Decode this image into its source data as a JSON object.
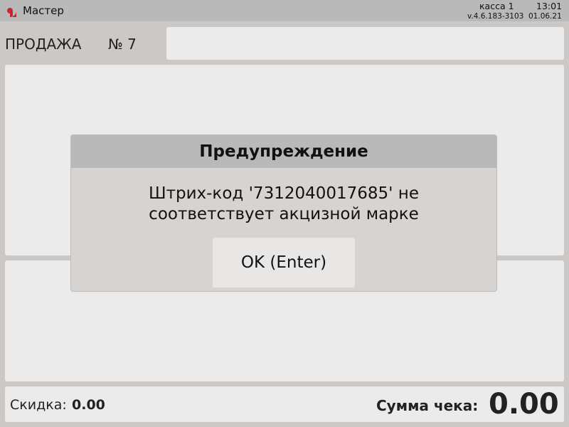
{
  "colors": {
    "background": "#cbc8c5",
    "topbar": "#b9b9b9",
    "panel": "#ebebeb",
    "dialog_body": "#d6d3d0",
    "dialog_header": "#b9b9b9",
    "logo_red": "#c8262f"
  },
  "header": {
    "logo_icon": "app-logo-icon",
    "app_title": "Мастер",
    "register": "касса 1",
    "time": "13:01",
    "version": "v.4.6.183-3103  01.06.21"
  },
  "sale": {
    "label": "ПРОДАЖА",
    "number": "№ 7"
  },
  "footer": {
    "discount_label": "Скидка:",
    "discount_value": "0.00",
    "total_label": "Сумма чека:",
    "total_value": "0.00"
  },
  "dialog": {
    "title": "Предупреждение",
    "message_line1": "Штрих-код '7312040017685' не",
    "message_line2": "соответствует акцизной марке",
    "ok_label": "OK (Enter)"
  }
}
